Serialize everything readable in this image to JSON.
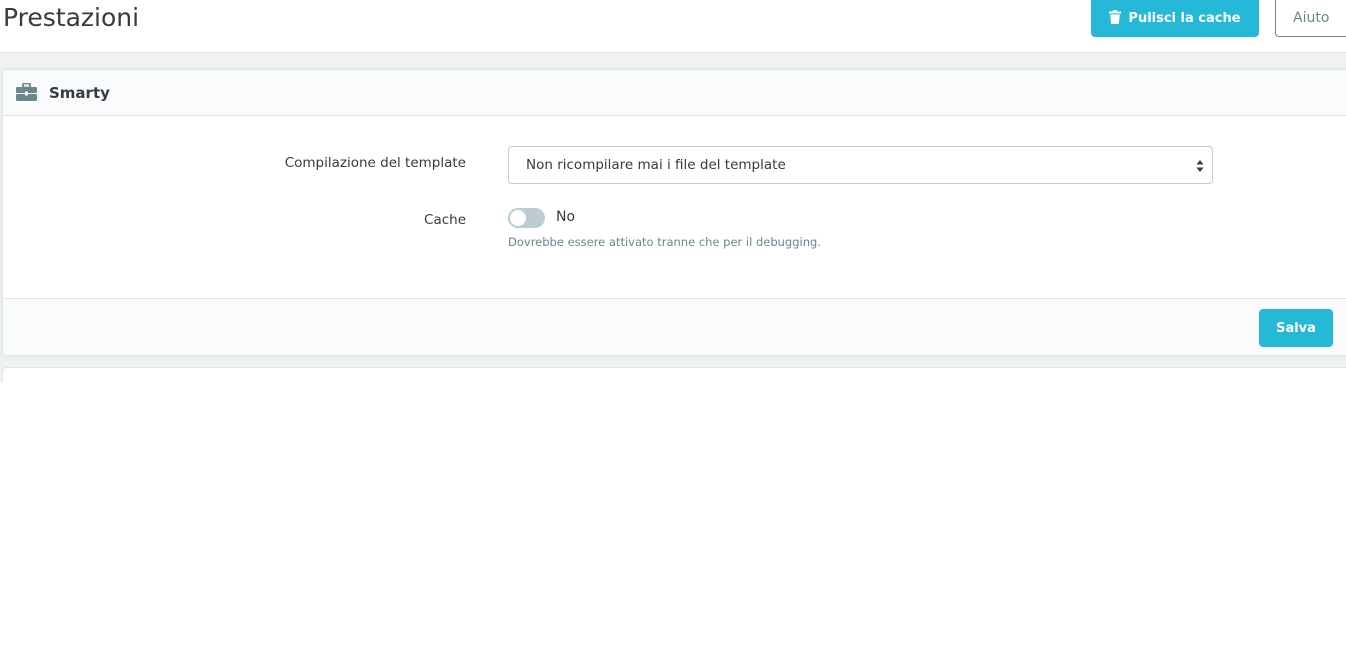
{
  "header": {
    "title": "Prestazioni",
    "clear_cache_label": "Pulisci la cache",
    "help_label": "Aiuto"
  },
  "smarty_panel": {
    "title": "Smarty",
    "template_compilation": {
      "label": "Compilazione del template",
      "selected_option": "Non ricompilare mai i file del template"
    },
    "cache": {
      "label": "Cache",
      "toggle_state": "No",
      "enabled": false,
      "help": "Dovrebbe essere attivato tranne che per il debugging."
    },
    "save_label": "Salva"
  },
  "icons": {
    "panel_heading": "briefcase-icon",
    "clear_cache": "trash-icon",
    "select": "sort-arrows-icon"
  },
  "colors": {
    "accent": "#25b9d7",
    "toggle_off": "#bbcdd2",
    "text": "#363a41",
    "muted": "#6c868e"
  }
}
